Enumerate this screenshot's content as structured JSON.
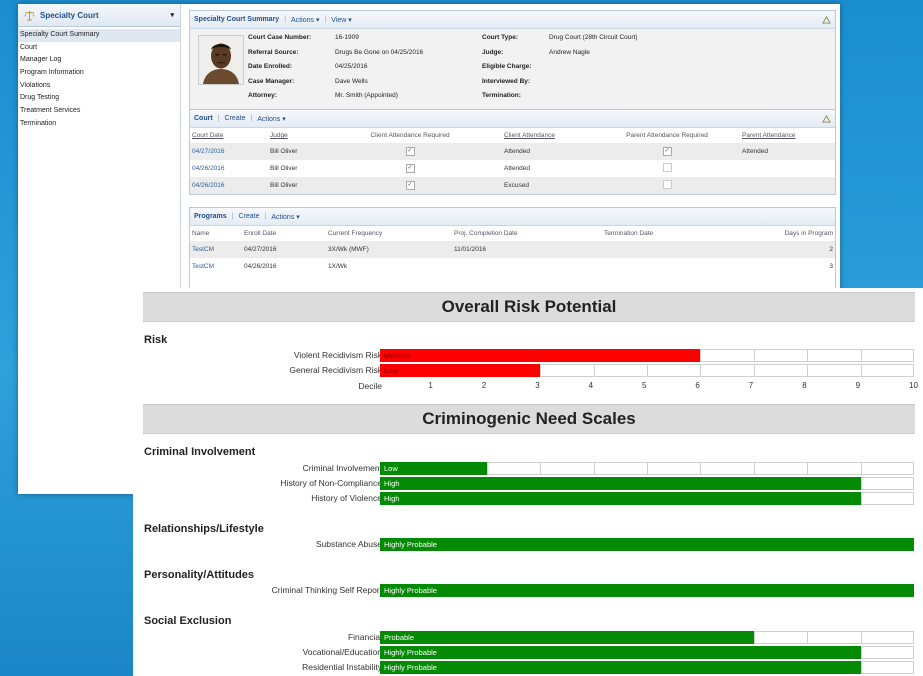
{
  "sidebar": {
    "title": "Specialty Court",
    "items": [
      {
        "label": "Specialty Court Summary"
      },
      {
        "label": "Court"
      },
      {
        "label": "Manager Log"
      },
      {
        "label": "Program Information"
      },
      {
        "label": "Violations"
      },
      {
        "label": "Drug Testing"
      },
      {
        "label": "Treatment Services"
      },
      {
        "label": "Termination"
      }
    ]
  },
  "summary_panel": {
    "title": "Specialty Court Summary",
    "actions_label": "Actions",
    "view_label": "View",
    "fields_left": [
      {
        "label": "Court Case Number:",
        "value": "16-1909"
      },
      {
        "label": "Referral Source:",
        "value": "Drugs Be Gone on 04/25/2016"
      },
      {
        "label": "Date Enrolled:",
        "value": "04/25/2016"
      },
      {
        "label": "Case Manager:",
        "value": "Dave Wells"
      },
      {
        "label": "Attorney:",
        "value": "Mr. Smith (Appointed)"
      }
    ],
    "fields_right": [
      {
        "label": "Court Type:",
        "value": "Drug Court (28th Circuit Court)"
      },
      {
        "label": "Judge:",
        "value": "Andrew Nagle"
      },
      {
        "label": "Eligible Charge:",
        "value": ""
      },
      {
        "label": "Interviewed By:",
        "value": ""
      },
      {
        "label": "Termination:",
        "value": ""
      }
    ]
  },
  "court_panel": {
    "title": "Court",
    "create_label": "Create",
    "actions_label": "Actions",
    "columns": [
      "Court Date",
      "Judge",
      "Client Attendance Required",
      "Client Attendance",
      "Parent Attendance Required",
      "Parent Attendance"
    ],
    "rows": [
      {
        "date": "04/27/2016",
        "judge": "Bill Oliver",
        "client_req": true,
        "client_att": "Attended",
        "parent_req": true,
        "parent_att": "Attended"
      },
      {
        "date": "04/26/2016",
        "judge": "Bill Oliver",
        "client_req": true,
        "client_att": "Attended",
        "parent_req": false,
        "parent_att": ""
      },
      {
        "date": "04/26/2016",
        "judge": "Bill Oliver",
        "client_req": true,
        "client_att": "Excused",
        "parent_req": false,
        "parent_att": ""
      }
    ]
  },
  "programs_panel": {
    "title": "Programs",
    "create_label": "Create",
    "actions_label": "Actions",
    "columns": [
      "Name",
      "Enroll Date",
      "Current Frequency",
      "Proj. Completion Date",
      "Termination Date",
      "Days in Program"
    ],
    "rows": [
      {
        "name": "TestCM",
        "enroll": "04/27/2016",
        "frequency": "3X/Wk (MWF)",
        "completion": "11/01/2016",
        "termination": "",
        "days": "2"
      },
      {
        "name": "TestCM",
        "enroll": "04/26/2016",
        "frequency": "1X/Wk",
        "completion": "",
        "termination": "",
        "days": "3"
      }
    ]
  },
  "report": {
    "risk_title": "Overall Risk Potential",
    "risk_section": "Risk",
    "risk_rows": [
      {
        "label": "Violent Recidivism Risk",
        "level": "Medium",
        "decile": 6,
        "color": "#ff0000"
      },
      {
        "label": "General Recidivism Risk",
        "level": "Low",
        "decile": 3,
        "color": "#ff0000"
      }
    ],
    "decile_label": "Decile",
    "decile_ticks": [
      "1",
      "2",
      "3",
      "4",
      "5",
      "6",
      "7",
      "8",
      "9",
      "10"
    ],
    "needs_title": "Criminogenic Need Scales",
    "need_sections": [
      {
        "title": "Criminal Involvement",
        "rows": [
          {
            "label": "Criminal Involvement",
            "level": "Low",
            "decile": 2
          },
          {
            "label": "History of Non-Compliance",
            "level": "High",
            "decile": 9
          },
          {
            "label": "History of Violence",
            "level": "High",
            "decile": 9
          }
        ]
      },
      {
        "title": "Relationships/Lifestyle",
        "rows": [
          {
            "label": "Substance Abuse",
            "level": "Highly Probable",
            "decile": 10
          }
        ]
      },
      {
        "title": "Personality/Attitudes",
        "rows": [
          {
            "label": "Criminal Thinking Self Report",
            "level": "Highly Probable",
            "decile": 10
          }
        ]
      },
      {
        "title": "Social Exclusion",
        "rows": [
          {
            "label": "Financial",
            "level": "Probable",
            "decile": 7
          },
          {
            "label": "Vocational/Education",
            "level": "Highly Probable",
            "decile": 9
          },
          {
            "label": "Residential Instability",
            "level": "Highly Probable",
            "decile": 9
          }
        ]
      }
    ],
    "need_bar_color": "#048a04"
  }
}
